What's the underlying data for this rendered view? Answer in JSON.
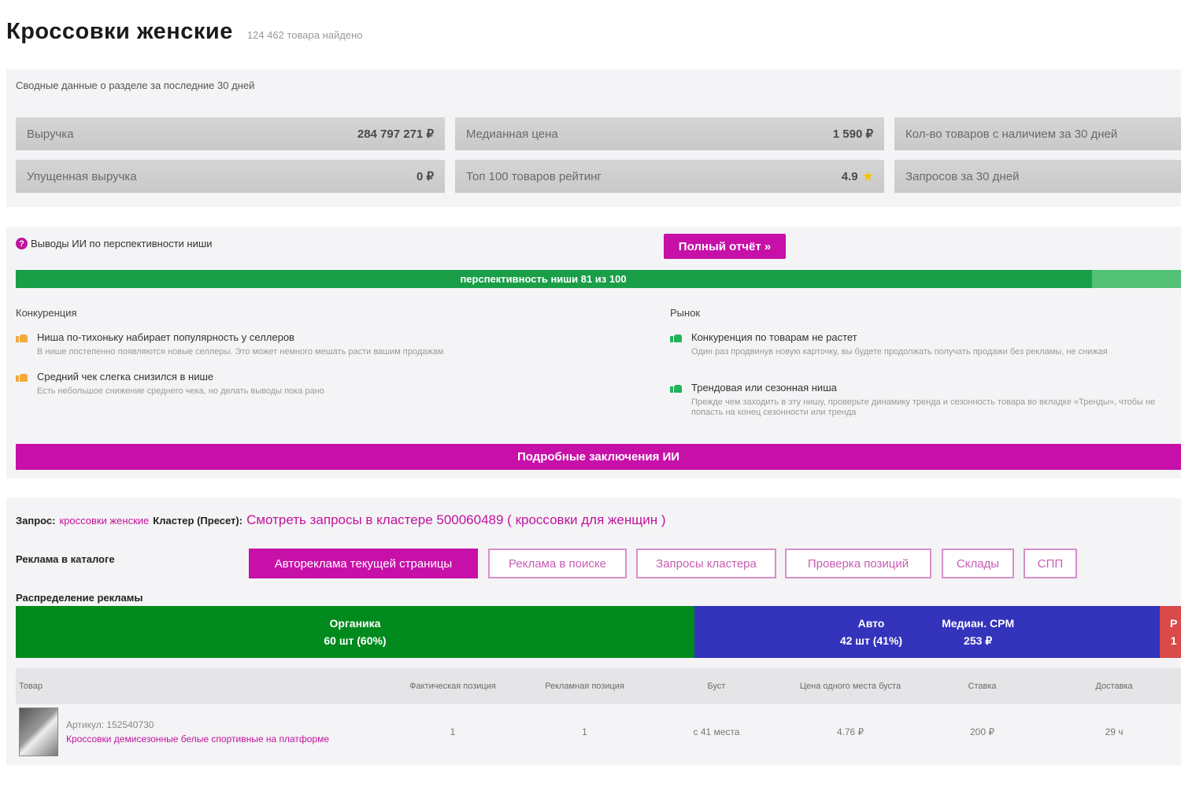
{
  "header": {
    "title": "Кроссовки женские",
    "found": "124 462 товара найдено"
  },
  "summary": {
    "caption": "Сводные данные о разделе за последние 30 дней",
    "metrics": [
      {
        "label": "Выручка",
        "value": "284 797 271 ₽"
      },
      {
        "label": "Медианная цена",
        "value": "1 590 ₽"
      },
      {
        "label": "Кол-во товаров с наличием за 30 дней",
        "value": ""
      },
      {
        "label": "Упущенная выручка",
        "value": "0 ₽"
      },
      {
        "label": "Топ 100 товаров рейтинг",
        "value": "4.9"
      },
      {
        "label": "Запросов за 30 дней",
        "value": ""
      }
    ]
  },
  "ai": {
    "title": "Выводы ИИ по перспективности ниши",
    "report_button": "Полный отчёт »",
    "prospect_label": "перспективность ниши 81 из 100",
    "prospect_score": 81,
    "competition_heading": "Конкуренция",
    "market_heading": "Рынок",
    "competition_items": [
      {
        "title": "Ниша по-тихоньку набирает популярность у селлеров",
        "desc": "В нише постепенно появляются новые селлеры. Это может немного мешать расти вашим продажам"
      },
      {
        "title": "Средний чек слегка снизился в нише",
        "desc": "Есть небольшое снижение среднего чека, но делать выводы пока рано"
      }
    ],
    "market_items": [
      {
        "title": "Конкуренция по товарам не растет",
        "desc": "Один раз продвинув новую карточку, вы будете продолжать получать продажи без рекламы, не снижая"
      },
      {
        "title": "Трендовая или сезонная ниша",
        "desc": "Прежде чем заходить в эту нишу, проверьте динамику тренда и сезонность товара во вкладке «Тренды», чтобы не попасть на конец сезонности или тренда"
      }
    ],
    "details_button": "Подробные заключения ИИ"
  },
  "ads": {
    "query_label": "Запрос:",
    "query_value": "кроссовки женские",
    "cluster_label": "Кластер (Пресет):",
    "cluster_link": "Смотреть запросы в кластере 500060489 ( кроссовки для женщин )",
    "catalog_label": "Реклама в каталоге",
    "tabs": [
      "Автореклама текущей страницы",
      "Реклама в поиске",
      "Запросы кластера",
      "Проверка позиций",
      "Склады",
      "СПП"
    ],
    "distribution_label": "Распределение рекламы",
    "distribution": {
      "organic": {
        "label": "Органика",
        "detail": "60 шт (60%)"
      },
      "auto": {
        "label": "Авто",
        "detail": "42 шт (41%)"
      },
      "median_cpm": {
        "label": "Медиан. CPM",
        "detail": "253 ₽"
      },
      "search": {
        "label": "Р",
        "detail": "1"
      }
    },
    "table": {
      "headers": [
        "Товар",
        "Фактическая позиция",
        "Рекламная позиция",
        "Буст",
        "Цена одного места буста",
        "Ставка",
        "Доставка"
      ],
      "rows": [
        {
          "article": "Артикул: 152540730",
          "name": "Кроссовки демисезонные белые спортивные на платформе",
          "fact_pos": "1",
          "ad_pos": "1",
          "boost": "с 41 места",
          "price": "4.76 ₽",
          "bid": "200 ₽",
          "delivery": "29 ч"
        }
      ]
    }
  }
}
